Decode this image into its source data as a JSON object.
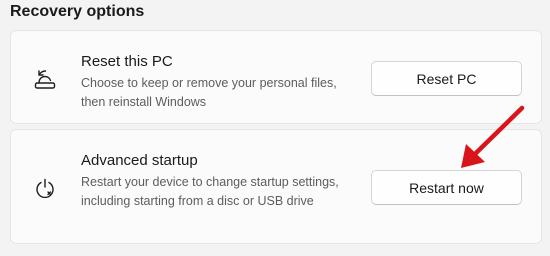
{
  "section": {
    "title": "Recovery options"
  },
  "reset": {
    "title": "Reset this PC",
    "description": "Choose to keep or remove your personal files, then reinstall Windows",
    "button_label": "Reset PC",
    "icon": "reset-pc-icon"
  },
  "advanced": {
    "title": "Advanced startup",
    "description": "Restart your device to change startup settings, including starting from a disc or USB drive",
    "button_label": "Restart now",
    "icon": "advanced-startup-icon"
  },
  "annotation": {
    "arrow_color": "#d8151b"
  }
}
